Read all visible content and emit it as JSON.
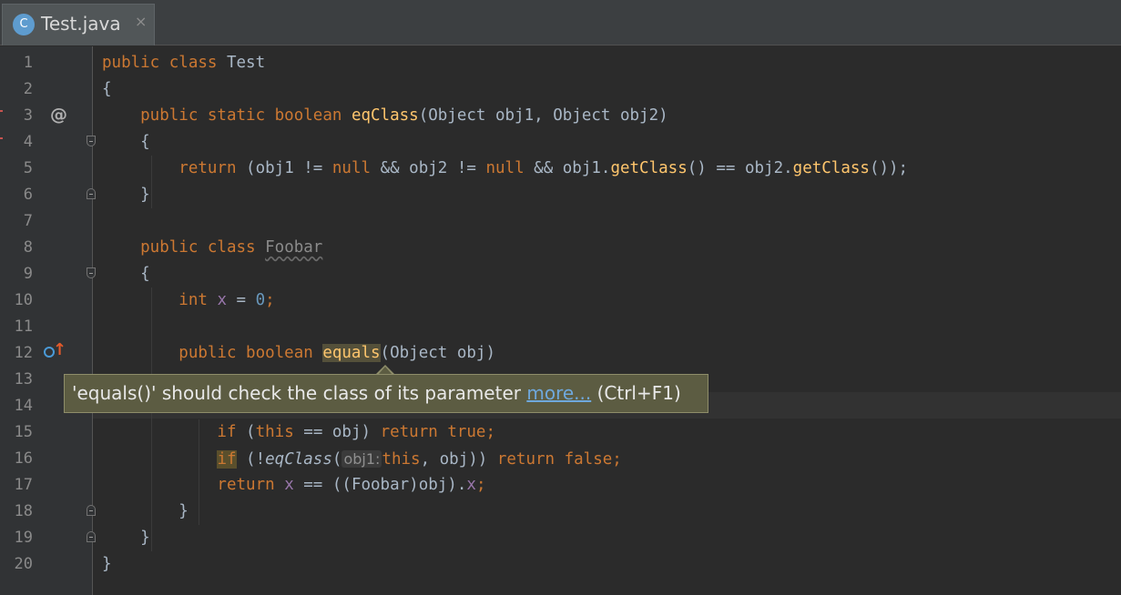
{
  "tab": {
    "icon_letter": "C",
    "title": "Test.java",
    "close_glyph": "×"
  },
  "gutter": {
    "line_numbers": [
      "1",
      "2",
      "3",
      "4",
      "5",
      "6",
      "7",
      "8",
      "9",
      "10",
      "11",
      "12",
      "13",
      "14",
      "15",
      "16",
      "17",
      "18",
      "19",
      "20"
    ],
    "implements_marker": "@",
    "overrides_marker": "↑"
  },
  "code": {
    "l1": {
      "a": "public class ",
      "b": "Test"
    },
    "l2": {
      "a": "{"
    },
    "l3": {
      "a": "    public static boolean ",
      "b": "eqClass",
      "c": "(Object obj1, Object obj2)"
    },
    "l4": {
      "a": "    {"
    },
    "l5": {
      "a": "        return ",
      "b": "(obj1 != ",
      "c": "null",
      "d": " && obj2 != ",
      "e": "null",
      "f": " && obj1.",
      "g": "getClass",
      "h": "() == obj2.",
      "i": "getClass",
      "j": "());"
    },
    "l6": {
      "a": "    }"
    },
    "l8": {
      "a": "    public class ",
      "b": "Foobar"
    },
    "l9": {
      "a": "    {"
    },
    "l10": {
      "a": "        int ",
      "b": "x",
      "c": " = ",
      "d": "0",
      "e": ";"
    },
    "l12": {
      "a": "        public boolean ",
      "b": "equals",
      "c": "(Object obj)"
    },
    "l15": {
      "a": "            if ",
      "b": "(",
      "c": "this",
      "d": " == obj) ",
      "e": "return true;"
    },
    "l16": {
      "a": "            ",
      "b": "if",
      "c": " (!",
      "d": "eqClass",
      "e": "(",
      "hint": "obj1:",
      "f": "this",
      "g": ", obj)) ",
      "h": "return false;"
    },
    "l17": {
      "a": "            return ",
      "b": "x",
      "c": " == ((Foobar)obj).",
      "d": "x",
      "e": ";"
    },
    "l18": {
      "a": "        }"
    },
    "l19": {
      "a": "    }"
    },
    "l20": {
      "a": "}"
    }
  },
  "tooltip": {
    "text": "'equals()' should check the class of its parameter ",
    "link": "more...",
    "shortcut": " (Ctrl+F1)"
  },
  "colors": {
    "background": "#2b2b2b",
    "keyword": "#cc7832",
    "method": "#ffc66d",
    "number": "#6897bb",
    "field": "#9876aa",
    "default_text": "#a9b7c6",
    "tooltip_bg": "#5c5c42"
  }
}
